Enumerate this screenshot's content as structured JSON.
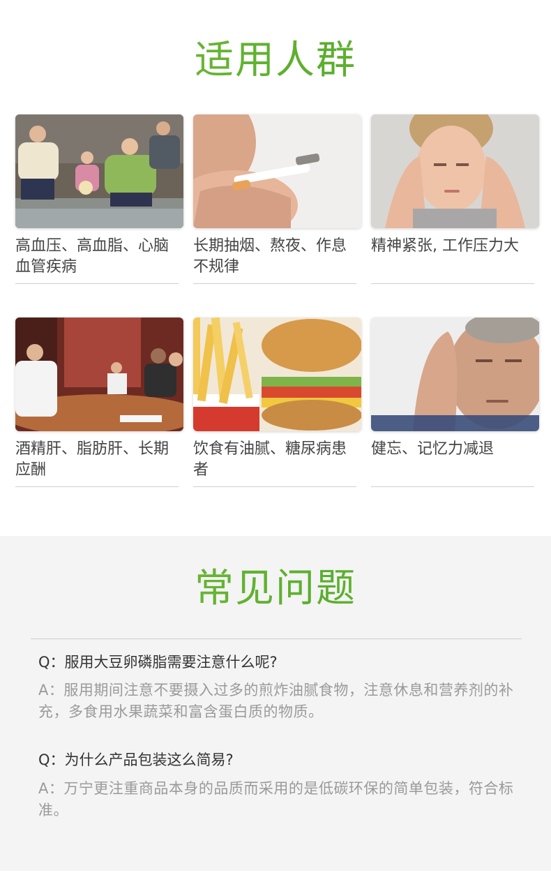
{
  "groups": {
    "title": "适用人群",
    "items": [
      {
        "caption": "高血压、高血脂、心脑血管疾病"
      },
      {
        "caption": "长期抽烟、熬夜、作息不规律"
      },
      {
        "caption": "精神紧张, 工作压力大"
      },
      {
        "caption": "酒精肝、脂肪肝、长期应酬"
      },
      {
        "caption": "饮食有油腻、糖尿病患者"
      },
      {
        "caption": "健忘、记忆力减退"
      }
    ]
  },
  "faq": {
    "title": "常见问题",
    "items": [
      {
        "q": "Q：服用大豆卵磷脂需要注意什么呢?",
        "a": "A：服用期间注意不要摄入过多的煎炸油腻食物，注意休息和营养剂的补充，多食用水果蔬菜和富含蛋白质的物质。"
      },
      {
        "q": "Q：为什么产品包装这么简易?",
        "a": "A：万宁更注重商品本身的品质而采用的是低碳环保的简单包装，符合标准。"
      }
    ]
  },
  "colors": {
    "accent_green": "#6fb83a",
    "faq_bg": "#f4f4f4"
  }
}
